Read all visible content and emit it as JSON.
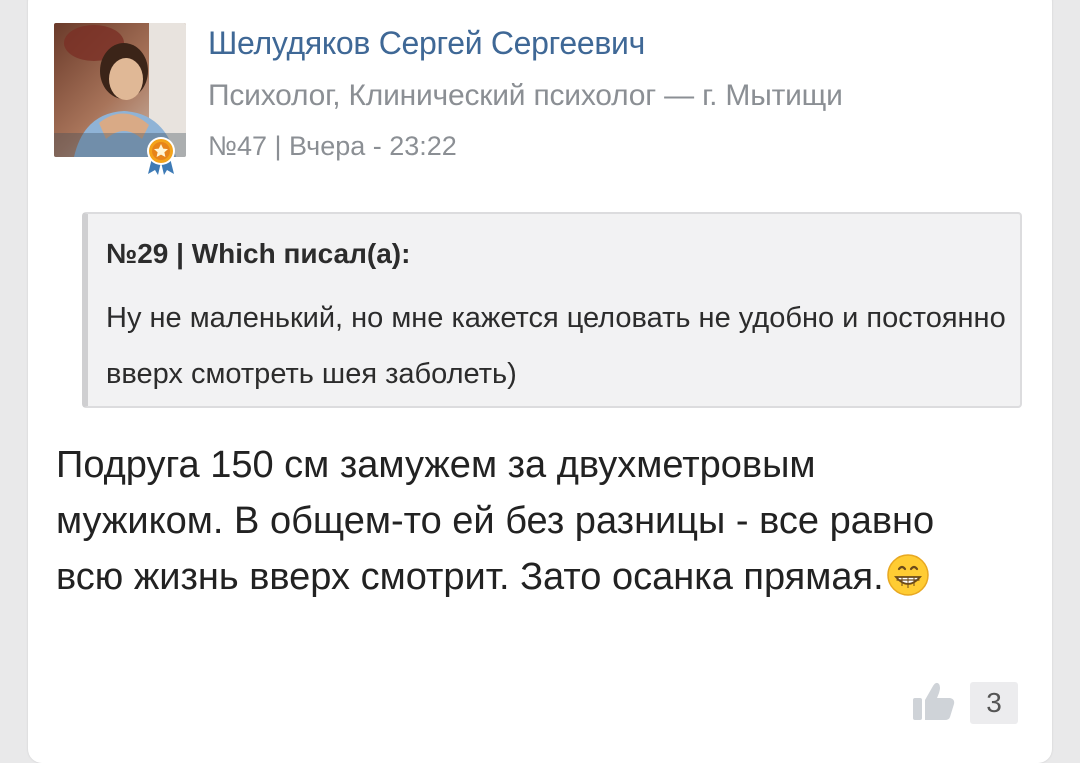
{
  "post": {
    "author_name": "Шелудяков Сергей Сергеевич",
    "author_role": "Психолог, Клинический психолог — г. Мытищи",
    "meta": "№47 | Вчера - 23:22",
    "quote": {
      "header": "№29 | Which писал(а):",
      "text": "Ну не маленький, но мне кажется целовать не удобно и постоянно вверх смотреть шея заболеть)"
    },
    "text": "Подруга 150 см замужем за двухметровым мужиком. В общем-то ей без разницы - все равно всю жизнь вверх смотрит. Зато осанка прямая.",
    "emoji_icon": "grinning-face-emoji",
    "likes": "3"
  },
  "icons": {
    "medal": "medal-icon",
    "like": "thumbs-up-icon"
  },
  "colors": {
    "author": "#3f6896",
    "meta": "#8b8f94",
    "quote_bg": "#f2f2f3"
  }
}
